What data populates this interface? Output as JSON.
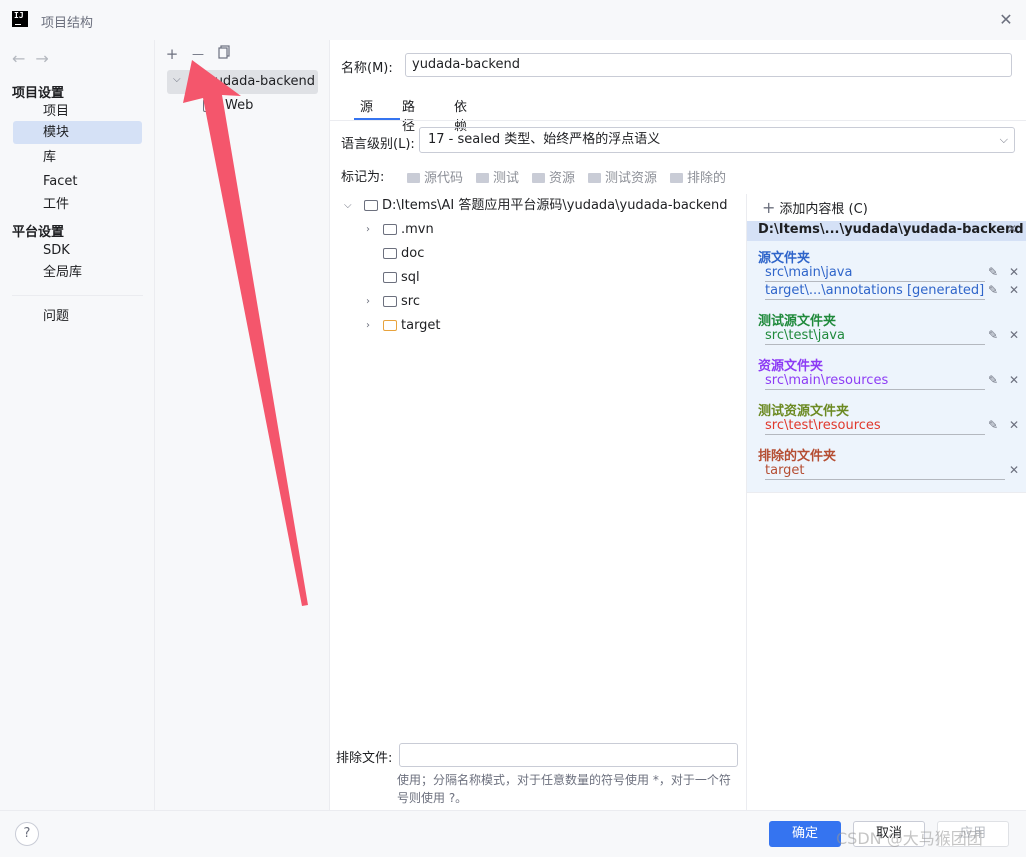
{
  "window": {
    "title": "项目结构",
    "app_icon_text": "IJ",
    "close_icon": "close-icon"
  },
  "nav": {
    "back_icon": "arrow-left-icon",
    "forward_icon": "arrow-right-icon",
    "project_settings_title": "项目设置",
    "project_settings_items": [
      "项目",
      "模块",
      "库",
      "Facet",
      "工件"
    ],
    "platform_settings_title": "平台设置",
    "platform_settings_items": [
      "SDK",
      "全局库"
    ],
    "problems": "问题",
    "selected": "模块"
  },
  "modules": {
    "toolbar": {
      "add": "+",
      "remove": "—",
      "copy_icon": "copy-icon"
    },
    "module_name": "yudada-backend",
    "facet": "Web"
  },
  "main": {
    "name_label": "名称(M):",
    "name_value": "yudada-backend",
    "tabs": [
      "源",
      "路径",
      "依赖"
    ],
    "active_tab": "源",
    "lang_label": "语言级别(L):",
    "lang_value": "17 - sealed 类型、始终严格的浮点语义",
    "mark_label": "标记为:",
    "mark_buttons": [
      "源代码",
      "测试",
      "资源",
      "测试资源",
      "排除的"
    ],
    "tree": {
      "root": "D:\\Items\\AI 答题应用平台源码\\yudada\\yudada-backend",
      "children": [
        ".mvn",
        "doc",
        "sql",
        "src",
        "target"
      ]
    },
    "exclude_label": "排除文件:",
    "exclude_value": "",
    "exclude_hint": "使用；分隔名称模式，对于任意数量的符号使用 *，对于一个符号则使用 ?。"
  },
  "roots": {
    "add_label": "添加内容根 (C)",
    "root_path": "D:\\Items\\...\\yudada\\yudada-backend",
    "sources_title": "源文件夹",
    "sources": [
      "src\\main\\java",
      "target\\...\\annotations [generated]"
    ],
    "test_sources_title": "测试源文件夹",
    "test_sources": [
      "src\\test\\java"
    ],
    "resources_title": "资源文件夹",
    "resources": [
      "src\\main\\resources"
    ],
    "test_resources_title": "测试资源文件夹",
    "test_resources": [
      "src\\test\\resources"
    ],
    "excluded_title": "排除的文件夹",
    "excluded": [
      "target"
    ]
  },
  "footer": {
    "help": "?",
    "ok": "确定",
    "cancel": "取消",
    "apply": "应用",
    "watermark": "CSDN @大马猴团团"
  },
  "colors": {
    "accent": "#3574f0",
    "arrow": "#f4566c",
    "selection": "#d5e1f6"
  }
}
